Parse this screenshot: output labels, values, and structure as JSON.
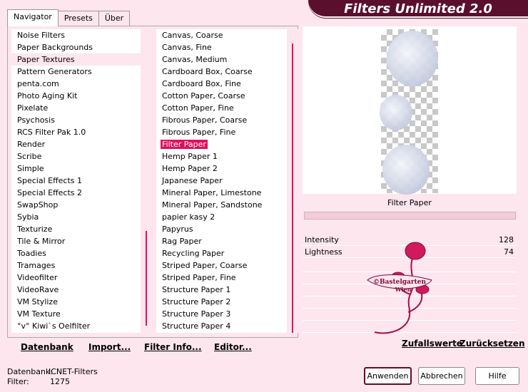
{
  "window_title": "Filters Unlimited 2.0",
  "tabs": [
    "Navigator",
    "Presets",
    "Über"
  ],
  "categories": [
    "Noise Filters",
    "Paper Backgrounds",
    "Paper Textures",
    "Pattern Generators",
    "penta.com",
    "Photo Aging Kit",
    "Pixelate",
    "Psychosis",
    "RCS Filter Pak 1.0",
    "Render",
    "Scribe",
    "Simple",
    "Special Effects 1",
    "Special Effects 2",
    "SwapShop",
    "Sybia",
    "Texturize",
    "Tile & Mirror",
    "Toadies",
    "Tramages",
    "Videofilter",
    "VideoRave",
    "VM Stylize",
    "VM Texture",
    "°v° Kiwi`s Oelfilter"
  ],
  "selected_category": "Paper Textures",
  "filters": [
    "Canvas, Coarse",
    "Canvas, Fine",
    "Canvas, Medium",
    "Cardboard Box, Coarse",
    "Cardboard Box, Fine",
    "Cotton Paper, Coarse",
    "Cotton Paper, Fine",
    "Fibrous Paper, Coarse",
    "Fibrous Paper, Fine",
    "Filter Paper",
    "Hemp Paper 1",
    "Hemp Paper 2",
    "Japanese Paper",
    "Mineral Paper, Limestone",
    "Mineral Paper, Sandstone",
    "papier kasy 2",
    "Papyrus",
    "Rag Paper",
    "Recycling Paper",
    "Striped Paper, Coarse",
    "Striped Paper, Fine",
    "Structure Paper 1",
    "Structure Paper 2",
    "Structure Paper 3",
    "Structure Paper 4"
  ],
  "selected_filter": "Filter Paper",
  "preview_filter_name": "Filter Paper",
  "params": [
    {
      "label": "Intensity",
      "value": "128"
    },
    {
      "label": "Lightness",
      "value": "74"
    }
  ],
  "left_buttons": [
    "Datenbank",
    "Import...",
    "Filter Info...",
    "Editor..."
  ],
  "right_links": [
    "Zufallswerte",
    "Zurücksetzen"
  ],
  "status": {
    "db_label": "Datenbank:",
    "db_value": "ICNET-Filters",
    "filter_label": "Filter:",
    "filter_value": "1275"
  },
  "buttons": {
    "apply": "Anwenden",
    "cancel": "Abbrechen",
    "help": "Hilfe"
  },
  "watermark": "©Bastelgarten Wien",
  "colors": {
    "accent": "#e0105e",
    "title_bg": "#5a0f2c",
    "panel_bg": "#fde6ee"
  }
}
